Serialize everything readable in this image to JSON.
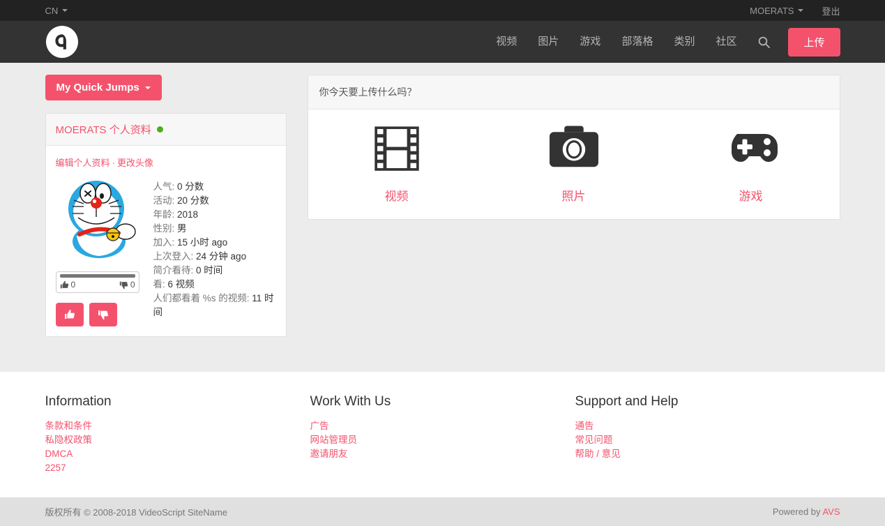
{
  "topbar": {
    "language": "CN",
    "username": "MOERATS",
    "logout": "登出"
  },
  "nav": {
    "items": [
      {
        "label": "视频"
      },
      {
        "label": "图片"
      },
      {
        "label": "游戏"
      },
      {
        "label": "部落格"
      },
      {
        "label": "类别"
      },
      {
        "label": "社区"
      }
    ],
    "search_icon": "search-icon",
    "upload_button": "上传"
  },
  "sidebar": {
    "quick_jumps": "My Quick Jumps",
    "profile_title": "MOERATS 个人资料",
    "edit_profile": "编辑个人资料",
    "separator": "·",
    "change_avatar": "更改头像",
    "rating": {
      "up_count": "0",
      "down_count": "0"
    },
    "stats": [
      {
        "label": "人气:",
        "value": "0 分数"
      },
      {
        "label": "活动:",
        "value": "20 分数"
      },
      {
        "label": "年龄:",
        "value": "2018"
      },
      {
        "label": "性别:",
        "value": "男"
      },
      {
        "label": "加入:",
        "value": "15 小时 ago"
      },
      {
        "label": "上次登入:",
        "value": "24 分钟 ago"
      },
      {
        "label": "简介看待:",
        "value": "0 时间"
      },
      {
        "label": "看:",
        "value": "6 视频"
      },
      {
        "label": "人们都看着 %s 的视频:",
        "value": "11 时间"
      }
    ]
  },
  "upload_panel": {
    "heading": "你今天要上传什么吗？",
    "items": [
      {
        "label": "视频",
        "icon": "film-icon"
      },
      {
        "label": "照片",
        "icon": "camera-icon"
      },
      {
        "label": "游戏",
        "icon": "gamepad-icon"
      }
    ]
  },
  "footer": {
    "columns": [
      {
        "title": "Information",
        "links": [
          "条款和条件",
          "私隐权政策",
          "DMCA",
          "2257"
        ]
      },
      {
        "title": "Work With Us",
        "links": [
          "广告",
          "网站管理员",
          "邀请朋友"
        ]
      },
      {
        "title": "Support and Help",
        "links": [
          "通告",
          "常见问题",
          "帮助 / 意见"
        ]
      }
    ],
    "copyright": "版权所有 © 2008-2018 VideoScript SiteName",
    "powered_by_prefix": "Powered by ",
    "powered_by_link": "AVS"
  },
  "colors": {
    "accent": "#f4526c",
    "topbar_bg": "#222222",
    "navbar_bg": "#333333",
    "body_bg": "#ececec",
    "online_dot": "#4caf17"
  }
}
